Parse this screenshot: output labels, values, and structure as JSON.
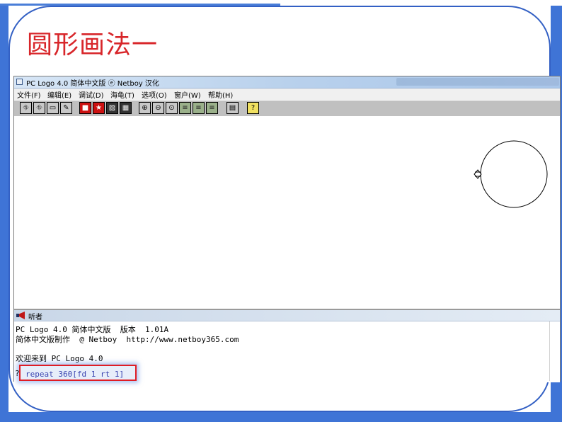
{
  "slide": {
    "title": "圆形画法一",
    "accent_color": "#3f74d6",
    "title_color": "#d8262a"
  },
  "window": {
    "title": "PC Logo 4.0 简体中文版  ⓔ Netboy  汉化"
  },
  "menu": [
    "文件(F)",
    "编辑(E)",
    "调试(D)",
    "海龟(T)",
    "选项(O)",
    "窗户(W)",
    "帮助(H)"
  ],
  "toolbar": {
    "buttons": [
      {
        "icon": "turtle-icon",
        "glyph": "⛗"
      },
      {
        "icon": "turtle-up-icon",
        "glyph": "⛗"
      },
      {
        "icon": "eraser-icon",
        "glyph": "▭"
      },
      {
        "icon": "pen-icon",
        "glyph": "✎"
      },
      {
        "icon": "stop-icon",
        "glyph": "■"
      },
      {
        "icon": "star-icon",
        "glyph": "★"
      },
      {
        "icon": "hatch-icon",
        "glyph": "▨"
      },
      {
        "icon": "pattern-icon",
        "glyph": "▦"
      },
      {
        "icon": "zoom-in-icon",
        "glyph": "⊕"
      },
      {
        "icon": "zoom-out-icon",
        "glyph": "⊖"
      },
      {
        "icon": "zoom-reset-icon",
        "glyph": "⊙"
      },
      {
        "icon": "traffic-light-icon",
        "glyph": "≡"
      },
      {
        "icon": "traffic-light-2-icon",
        "glyph": "≡"
      },
      {
        "icon": "traffic-light-3-icon",
        "glyph": "≡"
      },
      {
        "icon": "screen-icon",
        "glyph": "▤"
      },
      {
        "icon": "help-icon",
        "glyph": "?"
      }
    ]
  },
  "listener": {
    "label": "听者",
    "lines": [
      "PC Logo 4.0 简体中文版  版本  1.01A",
      "简体中文版制作  @ Netboy  http://www.netboy365.com",
      "",
      "欢迎来到 PC Logo 4.0"
    ],
    "prompt": "?",
    "command": "repeat 360[fd 1 rt 1]"
  },
  "turtle": {
    "icon": "turtle-icon"
  }
}
